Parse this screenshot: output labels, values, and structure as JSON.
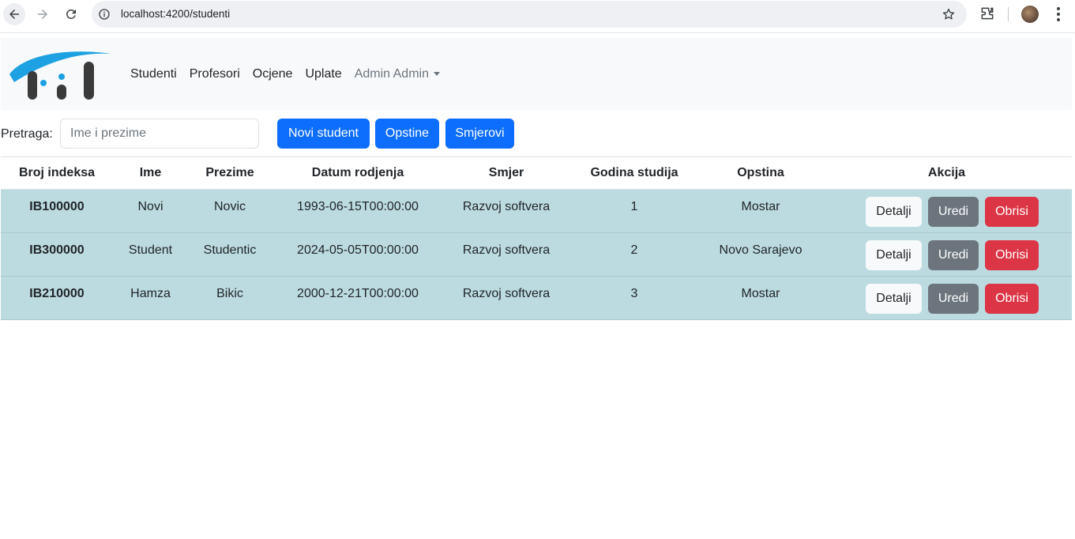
{
  "browser": {
    "url": "localhost:4200/studenti"
  },
  "navbar": {
    "links": [
      "Studenti",
      "Profesori",
      "Ocjene",
      "Uplate"
    ],
    "user_menu": "Admin Admin"
  },
  "search": {
    "label": "Pretraga:",
    "placeholder": "Ime i prezime",
    "value": ""
  },
  "toolbar": {
    "new_student": "Novi student",
    "municipalities": "Opstine",
    "majors": "Smjerovi"
  },
  "table": {
    "headers": [
      "Broj indeksa",
      "Ime",
      "Prezime",
      "Datum rodjenja",
      "Smjer",
      "Godina studija",
      "Opstina",
      "Akcija"
    ],
    "rows": [
      {
        "index": "IB100000",
        "first": "Novi",
        "last": "Novic",
        "dob": "1993-06-15T00:00:00",
        "major": "Razvoj softvera",
        "year": "1",
        "municipality": "Mostar"
      },
      {
        "index": "IB300000",
        "first": "Student",
        "last": "Studentic",
        "dob": "2024-05-05T00:00:00",
        "major": "Razvoj softvera",
        "year": "2",
        "municipality": "Novo Sarajevo"
      },
      {
        "index": "IB210000",
        "first": "Hamza",
        "last": "Bikic",
        "dob": "2000-12-21T00:00:00",
        "major": "Razvoj softvera",
        "year": "3",
        "municipality": "Mostar"
      }
    ],
    "actions": {
      "details": "Detalji",
      "edit": "Uredi",
      "delete": "Obrisi"
    }
  },
  "colors": {
    "primary": "#0d6efd",
    "secondary": "#6c757d",
    "danger": "#dc3545",
    "row_bg": "#bcdbe1",
    "navbar_bg": "#f8f9fa"
  }
}
